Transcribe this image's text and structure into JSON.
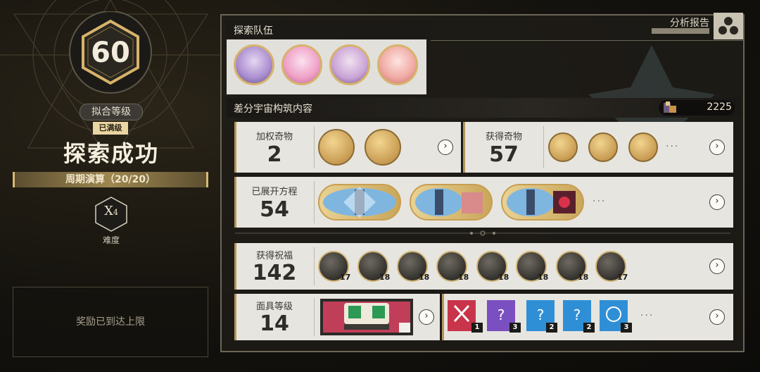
{
  "left": {
    "level": "60",
    "level_label": "拟合等级",
    "max_badge": "已满级",
    "result": "探索成功",
    "cycle": "周期演算（20/20）",
    "difficulty_value": "X",
    "difficulty_sub": "4",
    "difficulty_label": "难度",
    "reward_text": "奖励已到达上限"
  },
  "team": {
    "title": "探索队伍",
    "members": [
      "member-1",
      "member-2",
      "member-3",
      "member-4"
    ]
  },
  "analysis": {
    "label": "分析报告"
  },
  "content": {
    "title": "差分宇宙构筑内容",
    "currency": "2225"
  },
  "weighted_curios": {
    "title": "加权奇物",
    "count": "2"
  },
  "obtained_curios": {
    "title": "获得奇物",
    "count": "57",
    "more": "···"
  },
  "equations": {
    "title": "已展开方程",
    "count": "54",
    "more": "···"
  },
  "blessings": {
    "title": "获得祝福",
    "count": "142",
    "levels": [
      "17",
      "18",
      "18",
      "18",
      "18",
      "18",
      "18",
      "17"
    ]
  },
  "masks": {
    "title": "面具等级",
    "count": "14",
    "levels": [
      "1",
      "3",
      "2",
      "2",
      "3"
    ],
    "more": "···"
  },
  "colors": {
    "gold": "#d6b36c",
    "panel_light": "#e7e5df",
    "mask_red": "#c8344a",
    "mask_purple": "#7a4fc0",
    "mask_blue": "#2f8fd6"
  },
  "icons": {
    "arrow": "chevron-right-icon",
    "currency": "cosmic-fragment-icon"
  }
}
